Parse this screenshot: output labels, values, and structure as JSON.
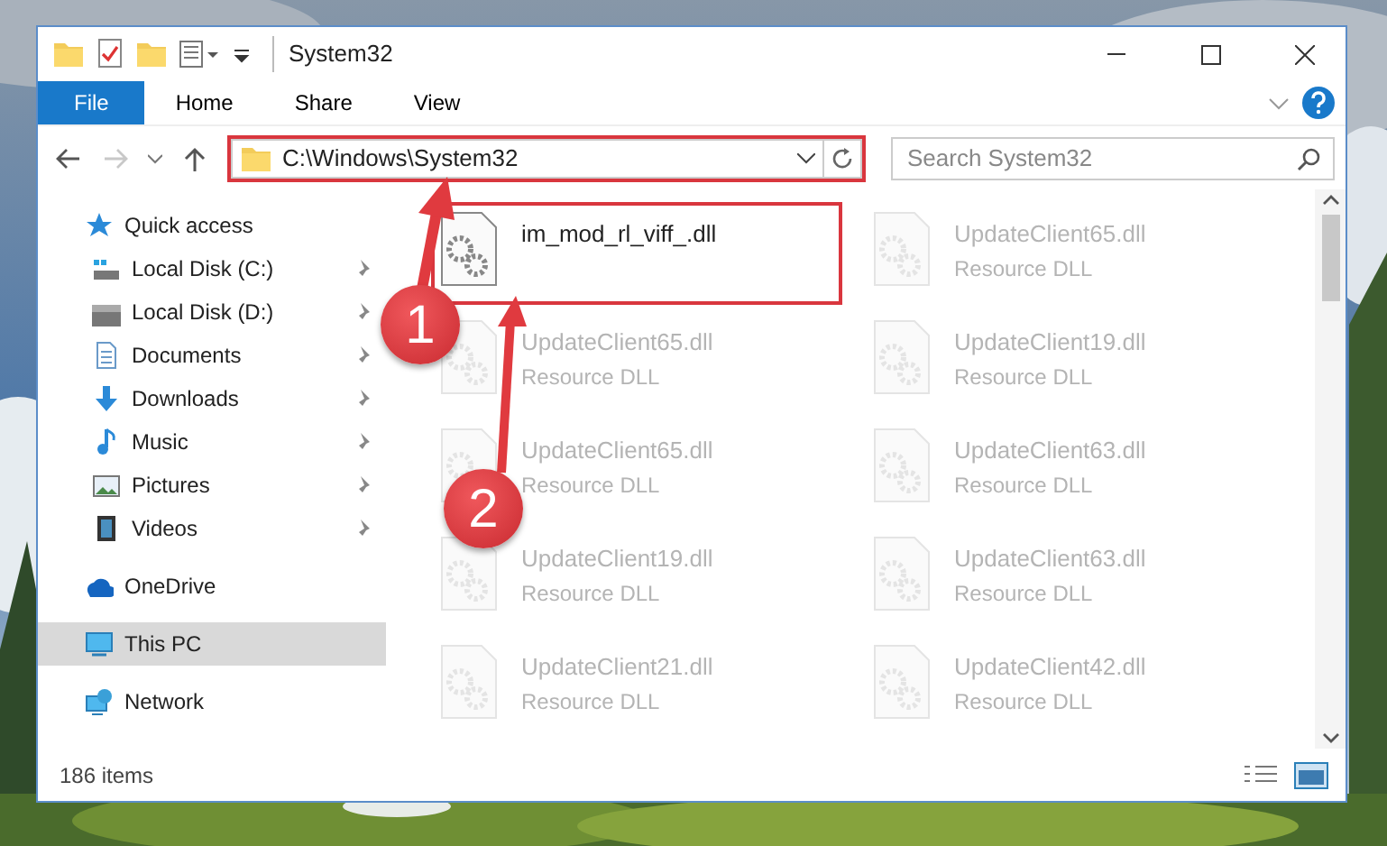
{
  "window": {
    "title": "System32"
  },
  "ribbon_tabs": [
    {
      "label": "File",
      "kind": "file-menu",
      "selected": false
    },
    {
      "label": "Home",
      "kind": "tab",
      "selected": false
    },
    {
      "label": "Share",
      "kind": "tab",
      "selected": false
    },
    {
      "label": "View",
      "kind": "tab",
      "selected": false
    }
  ],
  "address_bar": {
    "path": "C:\\Windows\\System32",
    "highlighted": true
  },
  "search": {
    "placeholder": "Search System32"
  },
  "navigation": [
    {
      "label": "Quick access",
      "selected": false,
      "children": [
        {
          "label": "Local Disk (C:)",
          "pinned": true
        },
        {
          "label": "Local Disk (D:)",
          "pinned": true
        },
        {
          "label": "Documents",
          "pinned": true
        },
        {
          "label": "Downloads",
          "pinned": true
        },
        {
          "label": "Music",
          "pinned": true
        },
        {
          "label": "Pictures",
          "pinned": true
        },
        {
          "label": "Videos",
          "pinned": true
        }
      ]
    },
    {
      "label": "OneDrive",
      "selected": false
    },
    {
      "label": "This PC",
      "selected": true
    },
    {
      "label": "Network",
      "selected": false
    }
  ],
  "files": [
    {
      "name": "im_mod_rl_viff_.dll",
      "highlighted": true,
      "faded": false
    },
    {
      "name": "UpdateClient65.dll",
      "type": "Resource DLL",
      "highlighted": false,
      "faded": true
    },
    {
      "name": "UpdateClient65.dll",
      "type": "Resource DLL",
      "highlighted": false,
      "faded": true
    },
    {
      "name": "UpdateClient19.dll",
      "type": "Resource DLL",
      "highlighted": false,
      "faded": true
    },
    {
      "name": "UpdateClient65.dll",
      "type": "Resource DLL",
      "highlighted": false,
      "faded": true
    },
    {
      "name": "UpdateClient63.dll",
      "type": "Resource DLL",
      "highlighted": false,
      "faded": true
    },
    {
      "name": "UpdateClient19.dll",
      "type": "Resource DLL",
      "highlighted": false,
      "faded": true
    },
    {
      "name": "UpdateClient63.dll",
      "type": "Resource DLL",
      "highlighted": false,
      "faded": true
    },
    {
      "name": "UpdateClient21.dll",
      "type": "Resource DLL",
      "highlighted": false,
      "faded": true
    },
    {
      "name": "UpdateClient42.dll",
      "type": "Resource DLL",
      "highlighted": false,
      "faded": true
    }
  ],
  "status_bar": {
    "item_count": "186 items"
  },
  "annotations": [
    {
      "label": "1"
    },
    {
      "label": "2"
    }
  ]
}
